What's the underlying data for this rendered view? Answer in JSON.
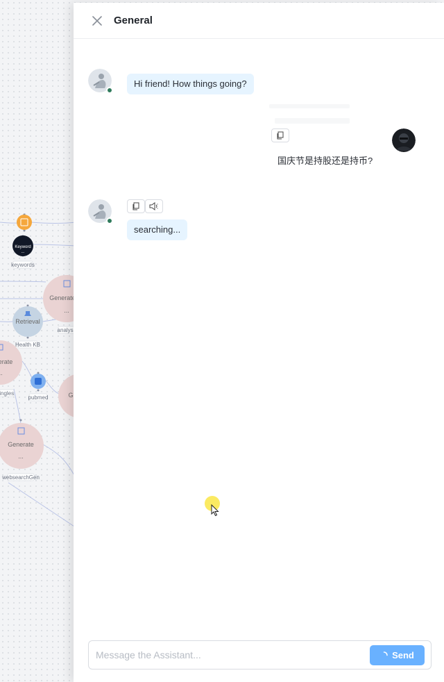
{
  "canvas": {
    "nodes": [
      {
        "name": "keyword-node",
        "title": "Keyword",
        "subtitle": "...",
        "label": "keywords"
      },
      {
        "name": "retrieval-node",
        "title": "Retrieval",
        "label": "Health KB"
      },
      {
        "name": "generate-node-1",
        "title": "Generate",
        "subtitle": "...",
        "label": "analysis"
      },
      {
        "name": "generate-node-2",
        "title": "enerate",
        "subtitle": "...",
        "label": "Singles"
      },
      {
        "name": "pubmed-node",
        "label": "pubmed"
      },
      {
        "name": "generate-node-3",
        "title": "G"
      },
      {
        "name": "generate-node-4",
        "title": "Generate",
        "subtitle": "...",
        "label": "websearchGen"
      }
    ]
  },
  "drawer": {
    "title": "General",
    "messages": [
      {
        "role": "assistant",
        "text": "Hi friend! How things going?"
      },
      {
        "role": "user",
        "text": "国庆节是持股还是持币?"
      },
      {
        "role": "assistant",
        "text": "searching..."
      }
    ],
    "input": {
      "placeholder": "Message the Assistant...",
      "value": ""
    },
    "send_label": "Send"
  }
}
